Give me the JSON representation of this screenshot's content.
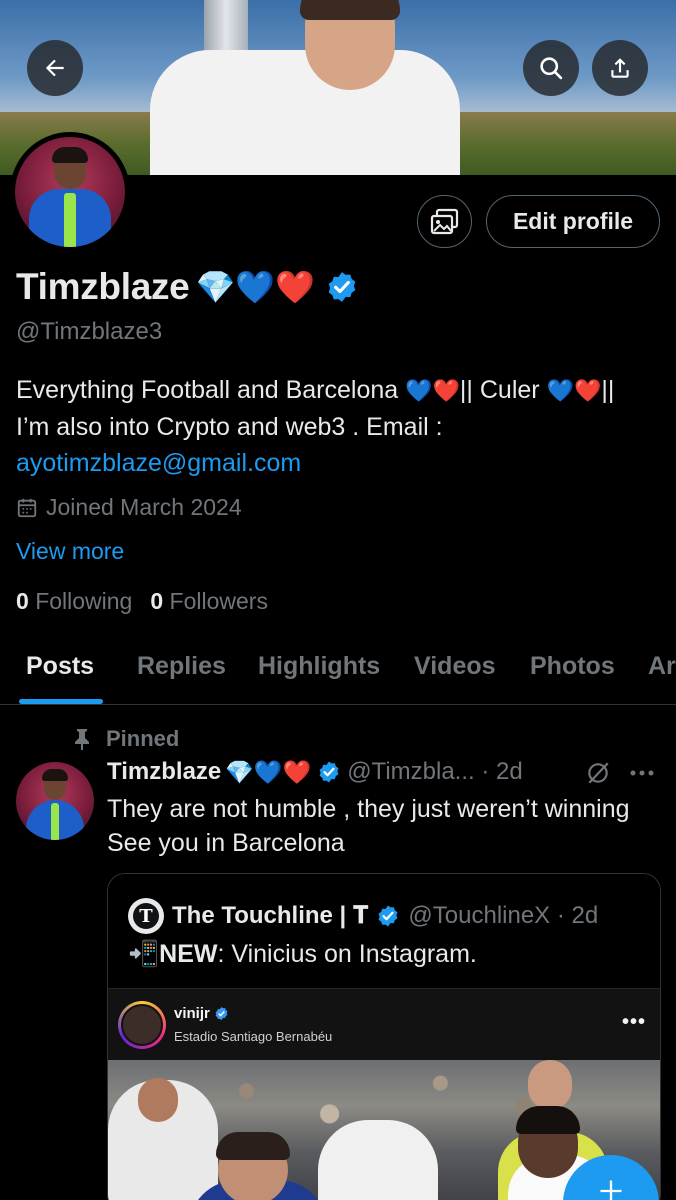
{
  "header": {
    "back_icon": "arrow-left-icon",
    "search_icon": "search-icon",
    "share_icon": "share-icon"
  },
  "profile": {
    "display_name": "Timzblaze",
    "name_emojis": "💎💙❤️",
    "handle": "@Timzblaze3",
    "edit_profile_label": "Edit profile",
    "bio_line1_a": "Everything Football and Barcelona ",
    "bio_line1_emoji_a": "💙❤️",
    "bio_line1_b": "|| Culer ",
    "bio_line1_emoji_b": "💙❤️",
    "bio_line1_c": "||",
    "bio_line2": "I’m also into Crypto and web3 . Email :",
    "bio_email": "ayotimzblaze@gmail.com",
    "joined": "Joined March 2024",
    "view_more": "View more",
    "following_count": "0",
    "following_label": "Following",
    "followers_count": "0",
    "followers_label": "Followers"
  },
  "tabs": [
    {
      "label": "Posts"
    },
    {
      "label": "Replies"
    },
    {
      "label": "Highlights"
    },
    {
      "label": "Videos"
    },
    {
      "label": "Photos"
    },
    {
      "label": "Ar"
    }
  ],
  "tweet": {
    "pinned_label": "Pinned",
    "name": "Timzblaze",
    "emojis": "💎💙❤️",
    "handle_time": "@Timzbla... · 2d",
    "text_line1": "They are not humble , they just weren’t winning",
    "text_line2": "See you in Barcelona",
    "quote": {
      "avatar_letter": "T",
      "name": "The Touchline | 𝐓",
      "handle_time": "@TouchlineX · 2d",
      "emoji": "📲",
      "text_bold": "NEW",
      "text_rest": ": Vinicius on Instagram.",
      "ig_user": "vinijr",
      "ig_location": "Estadio Santiago Bernabéu",
      "ig_more": "•••"
    }
  },
  "colors": {
    "accent": "#1d9bf0",
    "background": "#000000",
    "text": "#e7e9ea",
    "secondary_text": "#71767b"
  }
}
